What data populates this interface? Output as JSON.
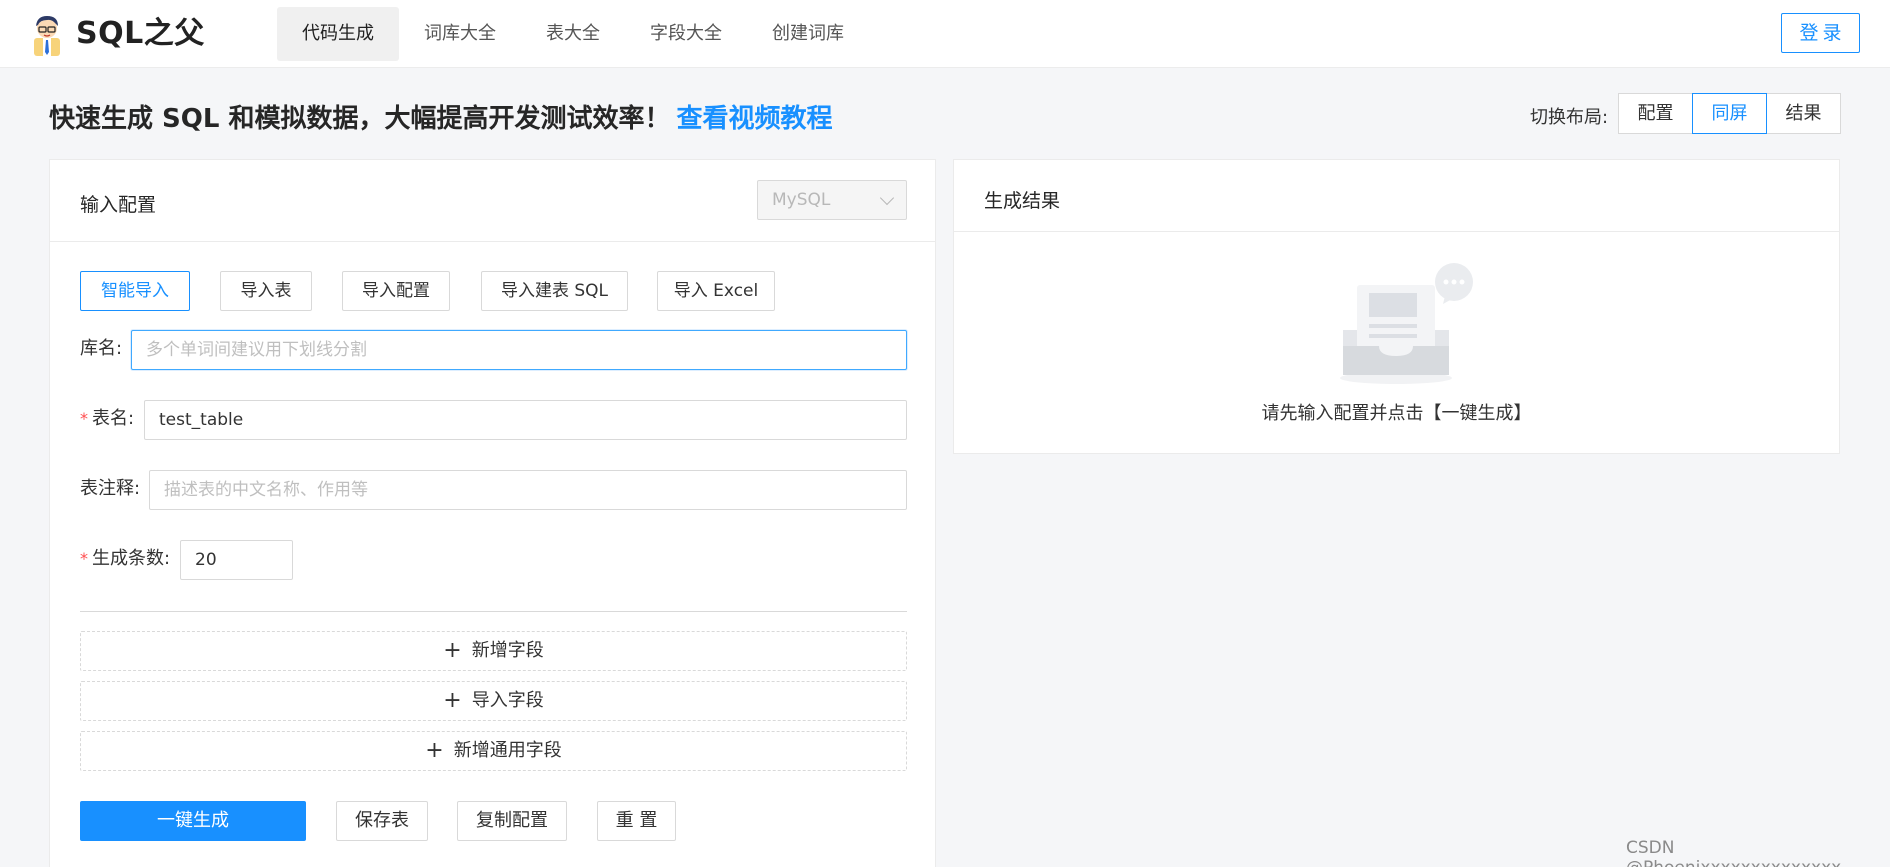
{
  "header": {
    "brand": "SQL之父",
    "nav": [
      {
        "label": "代码生成",
        "active": true
      },
      {
        "label": "词库大全",
        "active": false
      },
      {
        "label": "表大全",
        "active": false
      },
      {
        "label": "字段大全",
        "active": false
      },
      {
        "label": "创建词库",
        "active": false
      }
    ],
    "login_label": "登录"
  },
  "title_row": {
    "headline": "快速生成 SQL 和模拟数据，大幅提高开发测试效率！",
    "video_link": "查看视频教程",
    "layout_label": "切换布局:",
    "layout_options": [
      "配置",
      "同屏",
      "结果"
    ],
    "layout_selected": "同屏"
  },
  "config_panel": {
    "title": "输入配置",
    "db_type": "MySQL",
    "import_buttons": [
      "智能导入",
      "导入表",
      "导入配置",
      "导入建表 SQL",
      "导入 Excel"
    ],
    "fields": {
      "db_name": {
        "label": "库名:",
        "value": "",
        "placeholder": "多个单词间建议用下划线分割"
      },
      "table_name": {
        "label": "表名:",
        "value": "test_table",
        "required": true
      },
      "table_comment": {
        "label": "表注释:",
        "value": "",
        "placeholder": "描述表的中文名称、作用等"
      },
      "row_count": {
        "label": "生成条数:",
        "value": "20",
        "required": true
      }
    },
    "add_buttons": [
      "新增字段",
      "导入字段",
      "新增通用字段"
    ],
    "actions": [
      "一键生成",
      "保存表",
      "复制配置",
      "重 置"
    ]
  },
  "result_panel": {
    "title": "生成结果",
    "empty_text": "请先输入配置并点击【一键生成】"
  },
  "watermark": "CSDN @Phoenixxxxxxxxxxxxxx",
  "colors": {
    "accent": "#1890ff",
    "required": "#ff4d4f"
  }
}
